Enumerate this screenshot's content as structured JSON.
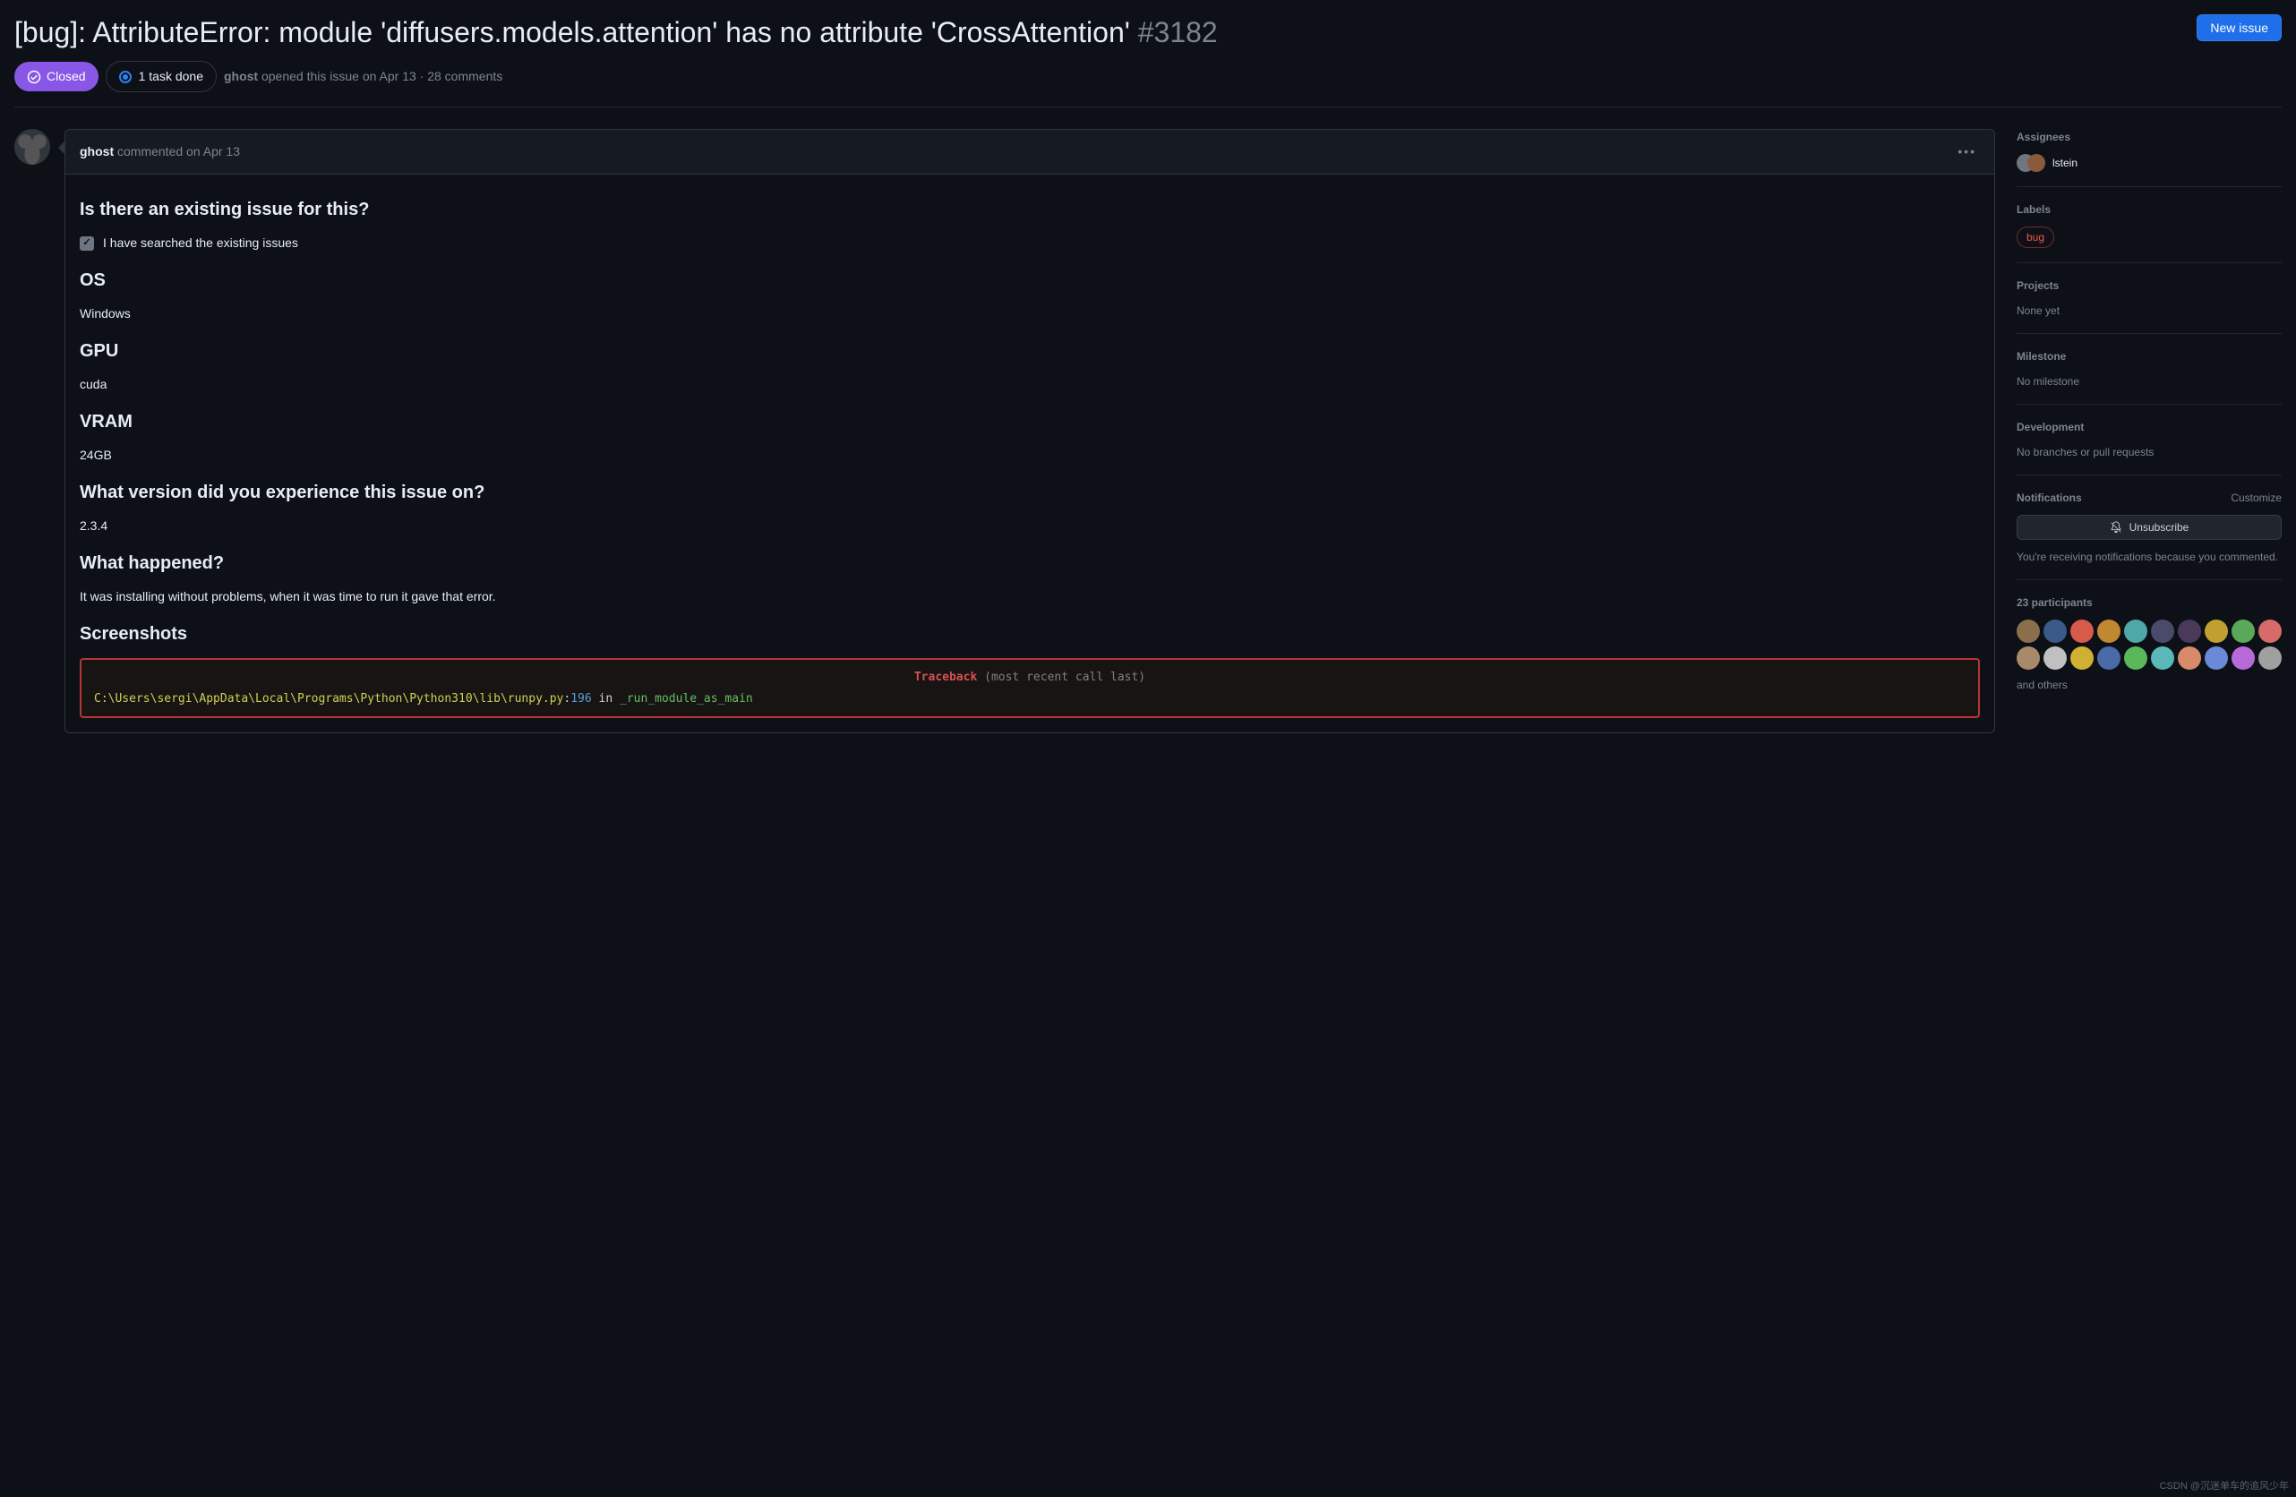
{
  "header": {
    "title_text": "[bug]: AttributeError: module 'diffusers.models.attention' has no attribute 'CrossAttention'",
    "issue_number": "#3182",
    "new_issue_label": "New issue",
    "state_label": "Closed",
    "task_done_label": "1 task done",
    "author": "ghost",
    "meta_suffix": " opened this issue on Apr 13 · 28 comments"
  },
  "comment": {
    "author": "ghost",
    "verb": "commented",
    "date": "on Apr 13",
    "sections": {
      "existing_heading": "Is there an existing issue for this?",
      "existing_task": "I have searched the existing issues",
      "os_heading": "OS",
      "os_value": "Windows",
      "gpu_heading": "GPU",
      "gpu_value": "cuda",
      "vram_heading": "VRAM",
      "vram_value": "24GB",
      "version_heading": "What version did you experience this issue on?",
      "version_value": "2.3.4",
      "happened_heading": "What happened?",
      "happened_value": "It was installing without problems, when it was time to run it gave that error.",
      "screenshots_heading": "Screenshots"
    },
    "traceback": {
      "label": "Traceback",
      "subtitle": "(most recent call last)",
      "path": "C:\\Users\\sergi\\AppData\\Local\\Programs\\Python\\Python310\\lib\\runpy.py",
      "line_no": "196",
      "in_word": " in ",
      "module": "_run_module_as_main"
    }
  },
  "sidebar": {
    "assignees_title": "Assignees",
    "assignee_name": "lstein",
    "labels_title": "Labels",
    "label_value": "bug",
    "projects_title": "Projects",
    "projects_value": "None yet",
    "milestone_title": "Milestone",
    "milestone_value": "No milestone",
    "development_title": "Development",
    "development_value": "No branches or pull requests",
    "notifications_title": "Notifications",
    "customize_label": "Customize",
    "unsubscribe_label": "Unsubscribe",
    "notif_reason": "You're receiving notifications because you commented.",
    "participants_title": "23 participants",
    "and_others": "and others"
  },
  "participant_colors": [
    "#8b6f4a",
    "#3a5a8a",
    "#d85a4a",
    "#c08830",
    "#4fa8a8",
    "#4a4a6a",
    "#4a3a5a",
    "#c0a030",
    "#5aa85a",
    "#d86a6a",
    "#a88a6a",
    "#c0c0c0",
    "#d0b030",
    "#4a6aa8",
    "#5ab85a",
    "#5ab8b8",
    "#d88a6a",
    "#6a8ad8",
    "#b86ad8",
    "#a0a0a0"
  ],
  "watermark": "CSDN @沉迷单车的追风少年"
}
